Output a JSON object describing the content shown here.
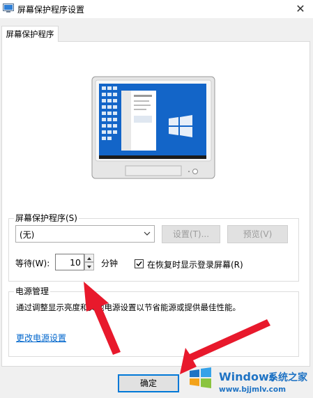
{
  "window": {
    "title": "屏幕保护程序设置"
  },
  "tabs": [
    {
      "label": "屏幕保护程序"
    }
  ],
  "screensaver_group": {
    "title": "屏幕保护程序(S)",
    "selected": "(无)",
    "settings_button": "设置(T)...",
    "preview_button": "预览(V)",
    "wait_label": "等待(W):",
    "wait_value": "10",
    "wait_unit": "分钟",
    "resume_checkbox_label": "在恢复时显示登录屏幕(R)",
    "resume_checked": true
  },
  "power_group": {
    "title": "电源管理",
    "description": "通过调整显示亮度和其他电源设置以节省能源或提供最佳性能。",
    "link": "更改电源设置"
  },
  "footer": {
    "ok_button": "确定"
  },
  "watermark": {
    "brand": "Windows",
    "brand_cn": "系统之家",
    "url": "www.bjjmlv.com"
  },
  "colors": {
    "annotation_arrow": "#e8192c",
    "link": "#0066cc",
    "accent": "#0078d7"
  }
}
